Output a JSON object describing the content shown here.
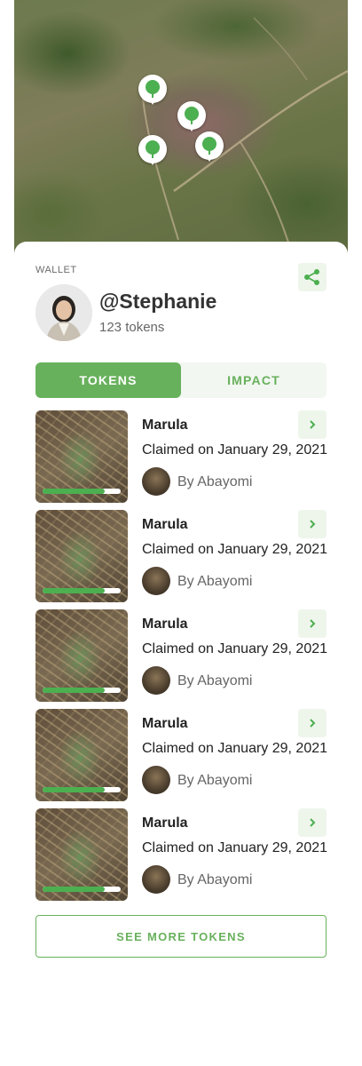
{
  "map": {
    "pin_count": 4,
    "pin_icon": "tree-icon",
    "pin_color": "#4caf50"
  },
  "wallet": {
    "label": "WALLET",
    "username": "@Stephanie",
    "token_count": "123 tokens",
    "share_icon": "share-icon"
  },
  "tabs": [
    {
      "label": "TOKENS",
      "active": true
    },
    {
      "label": "IMPACT",
      "active": false
    }
  ],
  "tokens": [
    {
      "species": "Marula",
      "claimed": "Claimed on January 29, 2021",
      "planter": "By Abayomi",
      "progress": 0.8
    },
    {
      "species": "Marula",
      "claimed": "Claimed on January 29, 2021",
      "planter": "By Abayomi",
      "progress": 0.8
    },
    {
      "species": "Marula",
      "claimed": "Claimed on January 29, 2021",
      "planter": "By Abayomi",
      "progress": 0.8
    },
    {
      "species": "Marula",
      "claimed": "Claimed on January 29, 2021",
      "planter": "By Abayomi",
      "progress": 0.8
    },
    {
      "species": "Marula",
      "claimed": "Claimed on January 29, 2021",
      "planter": "By Abayomi",
      "progress": 0.8
    }
  ],
  "see_more_label": "SEE MORE TOKENS",
  "colors": {
    "accent": "#68b15c",
    "accent_light": "#eef6ec",
    "progress": "#4caf50"
  }
}
